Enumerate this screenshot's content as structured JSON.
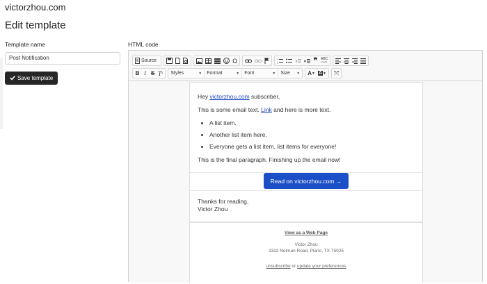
{
  "site": {
    "title": "victorzhou.com"
  },
  "page": {
    "title": "Edit template"
  },
  "form": {
    "template_name_label": "Template name",
    "template_name_value": "Post Notification",
    "save_button": "Save template",
    "html_code_label": "HTML code"
  },
  "toolbar": {
    "source_label": "Source",
    "styles": "Styles",
    "format": "Format",
    "font": "Font",
    "size": "Size"
  },
  "email": {
    "greeting_prefix": "Hey ",
    "greeting_link": "victorzhou.com",
    "greeting_suffix": " subscriber,",
    "para1_prefix": "This is some email text. ",
    "para1_link": "Link",
    "para1_suffix": " and here is more text.",
    "list": [
      "A list item.",
      "Another list item here.",
      "Everyone gets a list item, list items for everyone!"
    ],
    "final_para": "This is the final paragraph. Finishing up the email now!",
    "button": "Read on victorzhou.com →",
    "thanks": "Thanks for reading,",
    "signature": "Victor Zhou",
    "footer": {
      "web_link": "View as a Web Page",
      "name": "Victor Zhou",
      "address": "3332 Neiman Road, Plano, TX 75025",
      "unsubscribe": "unsubscribe",
      "or": " or ",
      "preferences": "update your preferences"
    }
  },
  "colors": {
    "accent": "#1a4fc7",
    "save_button_bg": "#262626",
    "link": "#1a44c3"
  }
}
